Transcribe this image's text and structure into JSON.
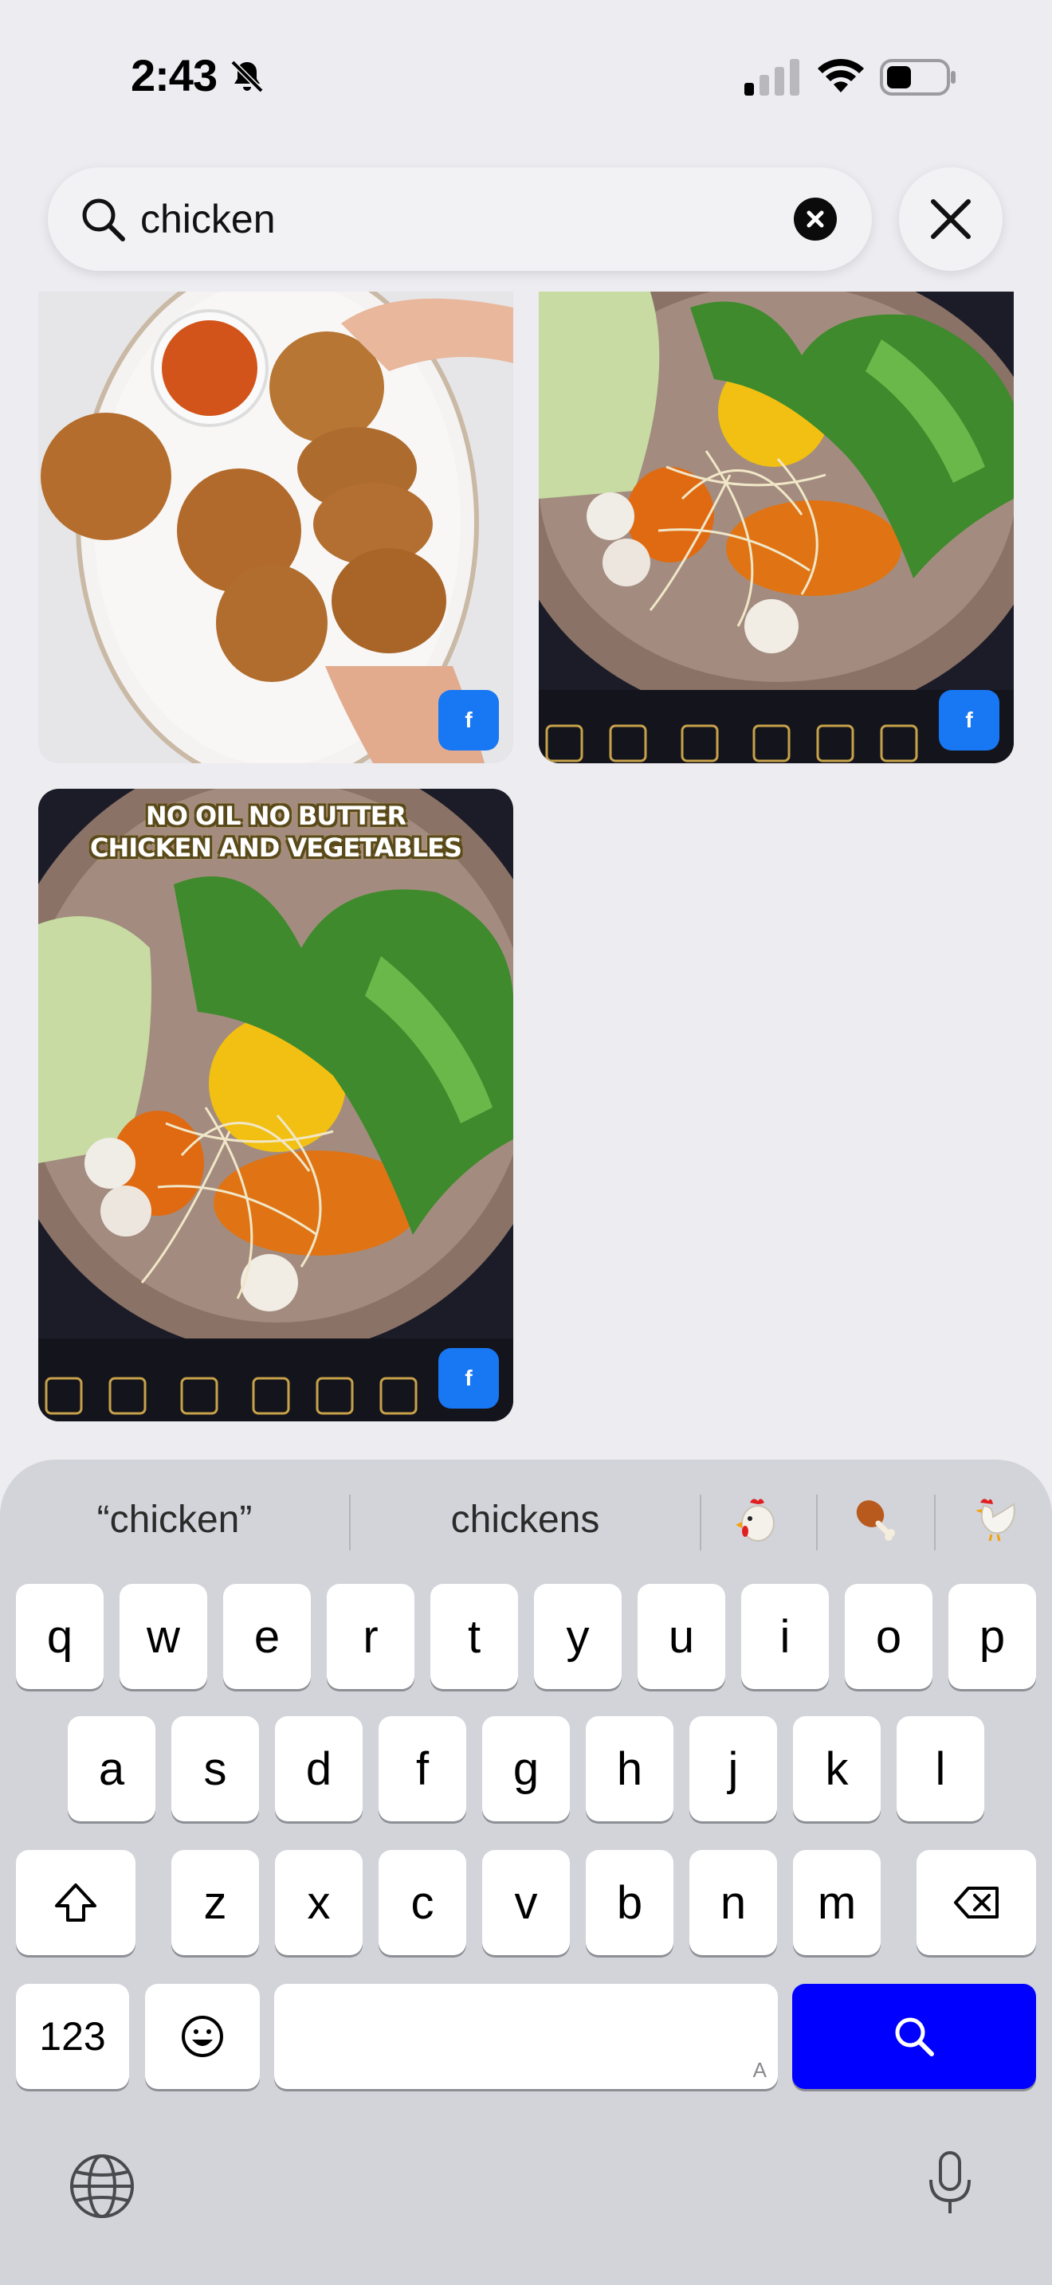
{
  "status_bar": {
    "time": "2:43"
  },
  "search": {
    "query": "chicken"
  },
  "results": [
    {
      "badge": "f"
    },
    {
      "badge": "f"
    },
    {
      "badge": "f",
      "overlay_line1": "NO OIL NO BUTTER",
      "overlay_line2": "CHICKEN AND VEGETABLES"
    }
  ],
  "suggestions": {
    "quoted": "“chicken”",
    "plural": "chickens",
    "emoji": [
      "chicken-face",
      "poultry-leg",
      "rooster"
    ]
  },
  "keyboard": {
    "row1": [
      "q",
      "w",
      "e",
      "r",
      "t",
      "y",
      "u",
      "i",
      "o",
      "p"
    ],
    "row2": [
      "a",
      "s",
      "d",
      "f",
      "g",
      "h",
      "j",
      "k",
      "l"
    ],
    "row3": [
      "z",
      "x",
      "c",
      "v",
      "b",
      "n",
      "m"
    ],
    "numbers_label": "123",
    "space_hint": "A",
    "search_key_color": "#0000ff"
  },
  "colors": {
    "fb_blue": "#1877f2",
    "background": "#ececf1"
  }
}
